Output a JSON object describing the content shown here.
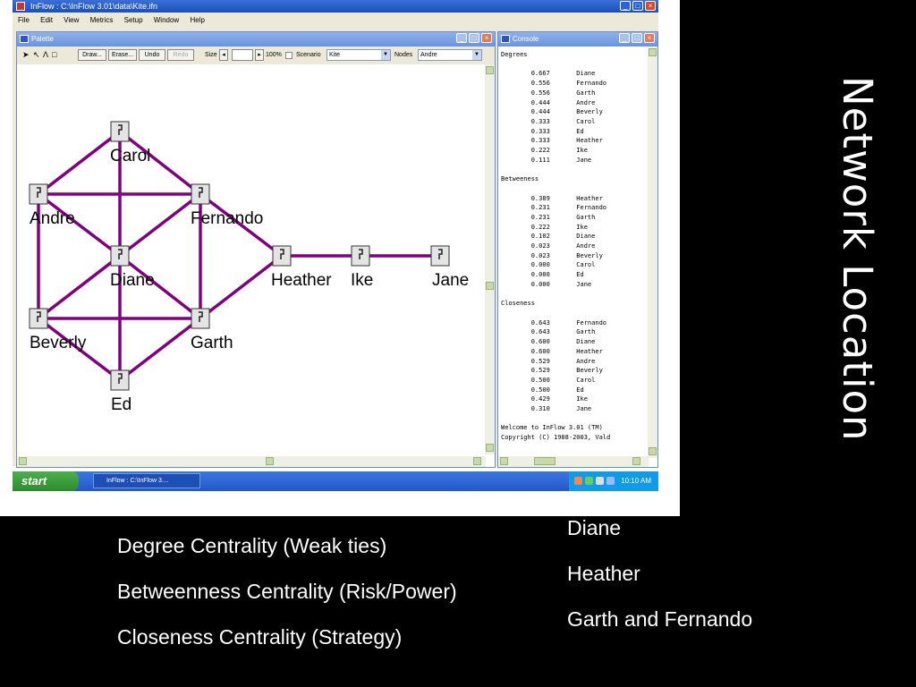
{
  "window": {
    "title": "InFlow : C:\\InFlow 3.01\\data\\Kite.ifn"
  },
  "menu": [
    "File",
    "Edit",
    "View",
    "Metrics",
    "Setup",
    "Window",
    "Help"
  ],
  "palette": {
    "title": "Palette",
    "toolbar": {
      "draw": "Draw...",
      "erase": "Erase...",
      "undo": "Undo",
      "redo": "Redo",
      "size_label": "Size",
      "zoom": "100%",
      "scenario_label": "Scenario",
      "scenario_value": "Kite",
      "nodes_label": "Nodes",
      "nodes_value": "Andre"
    },
    "nodes": [
      {
        "id": "carol",
        "label": "Carol"
      },
      {
        "id": "andre",
        "label": "Andre"
      },
      {
        "id": "fernando",
        "label": "Fernando"
      },
      {
        "id": "diane",
        "label": "Diane"
      },
      {
        "id": "heather",
        "label": "Heather"
      },
      {
        "id": "ike",
        "label": "Ike"
      },
      {
        "id": "jane",
        "label": "Jane"
      },
      {
        "id": "beverly",
        "label": "Beverly"
      },
      {
        "id": "garth",
        "label": "Garth"
      },
      {
        "id": "ed",
        "label": "Ed"
      }
    ],
    "edges": [
      [
        "carol",
        "andre"
      ],
      [
        "carol",
        "fernando"
      ],
      [
        "carol",
        "diane"
      ],
      [
        "andre",
        "fernando"
      ],
      [
        "andre",
        "diane"
      ],
      [
        "andre",
        "beverly"
      ],
      [
        "fernando",
        "diane"
      ],
      [
        "fernando",
        "garth"
      ],
      [
        "fernando",
        "heather"
      ],
      [
        "diane",
        "beverly"
      ],
      [
        "diane",
        "garth"
      ],
      [
        "diane",
        "ed"
      ],
      [
        "beverly",
        "garth"
      ],
      [
        "beverly",
        "ed"
      ],
      [
        "garth",
        "ed"
      ],
      [
        "garth",
        "heather"
      ],
      [
        "heather",
        "ike"
      ],
      [
        "ike",
        "jane"
      ]
    ],
    "edge_color": "#800080"
  },
  "console": {
    "title": "Console",
    "sections": [
      {
        "heading": "Degrees",
        "rows": [
          [
            "0.667",
            "Diane"
          ],
          [
            "0.556",
            "Fernando"
          ],
          [
            "0.556",
            "Garth"
          ],
          [
            "0.444",
            "Andre"
          ],
          [
            "0.444",
            "Beverly"
          ],
          [
            "0.333",
            "Carol"
          ],
          [
            "0.333",
            "Ed"
          ],
          [
            "0.333",
            "Heather"
          ],
          [
            "0.222",
            "Ike"
          ],
          [
            "0.111",
            "Jane"
          ]
        ]
      },
      {
        "heading": "Betweeness",
        "rows": [
          [
            "0.389",
            "Heather"
          ],
          [
            "0.231",
            "Fernando"
          ],
          [
            "0.231",
            "Garth"
          ],
          [
            "0.222",
            "Ike"
          ],
          [
            "0.102",
            "Diane"
          ],
          [
            "0.023",
            "Andre"
          ],
          [
            "0.023",
            "Beverly"
          ],
          [
            "0.000",
            "Carol"
          ],
          [
            "0.000",
            "Ed"
          ],
          [
            "0.000",
            "Jane"
          ]
        ]
      },
      {
        "heading": "Closeness",
        "rows": [
          [
            "0.643",
            "Fernando"
          ],
          [
            "0.643",
            "Garth"
          ],
          [
            "0.600",
            "Diane"
          ],
          [
            "0.600",
            "Heather"
          ],
          [
            "0.529",
            "Andre"
          ],
          [
            "0.529",
            "Beverly"
          ],
          [
            "0.500",
            "Carol"
          ],
          [
            "0.500",
            "Ed"
          ],
          [
            "0.429",
            "Ike"
          ],
          [
            "0.310",
            "Jane"
          ]
        ]
      }
    ],
    "footer": [
      "Welcome to InFlow 3.01 (TM)",
      "Copyright (C) 1988-2003, Vald"
    ]
  },
  "taskbar": {
    "start": "start",
    "task": "InFlow : C:\\InFlow 3....",
    "clock": "10:10 AM"
  },
  "slide": {
    "title": "Network Location",
    "measures": [
      "Degree Centrality (Weak ties)",
      "Betweenness Centrality (Risk/Power)",
      "Closeness Centrality (Strategy)"
    ],
    "answers": [
      "Diane",
      "Heather",
      "Garth and Fernando"
    ]
  }
}
